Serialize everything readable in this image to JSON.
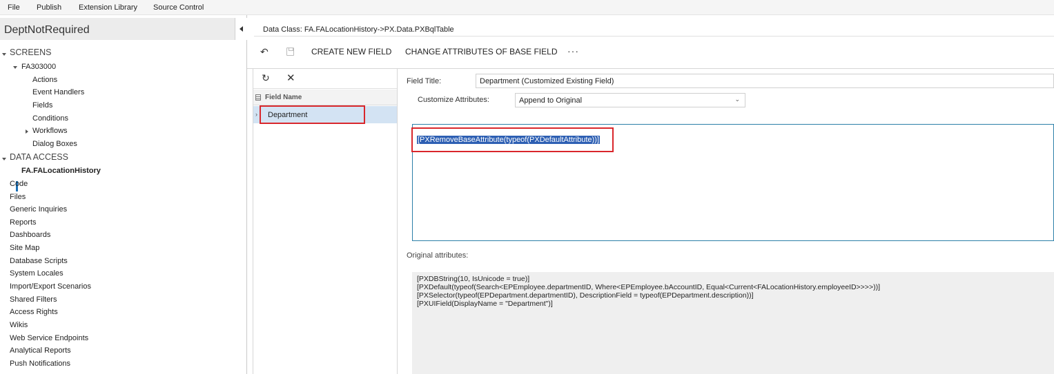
{
  "menubar": {
    "items": [
      "File",
      "Publish",
      "Extension Library",
      "Source Control"
    ]
  },
  "project": {
    "title": "DeptNotRequired"
  },
  "tree": {
    "screens_label": "SCREENS",
    "screen_id": "FA303000",
    "screen_children": [
      "Actions",
      "Event Handlers",
      "Fields",
      "Conditions",
      "Workflows",
      "Dialog Boxes"
    ],
    "data_access_label": "DATA ACCESS",
    "data_class": "FA.FALocationHistory",
    "other_items": [
      "Code",
      "Files",
      "Generic Inquiries",
      "Reports",
      "Dashboards",
      "Site Map",
      "Database Scripts",
      "System Locales",
      "Import/Export Scenarios",
      "Shared Filters",
      "Access Rights",
      "Wikis",
      "Web Service Endpoints",
      "Analytical Reports",
      "Push Notifications"
    ]
  },
  "main": {
    "data_class_text": "Data Class: FA.FALocationHistory->PX.Data.PXBqlTable",
    "toolbar": {
      "create_field": "CREATE NEW FIELD",
      "change_attributes": "CHANGE ATTRIBUTES OF BASE FIELD",
      "more": "···"
    },
    "fields": {
      "header": "Field Name",
      "rows": [
        "Department"
      ]
    },
    "field_title_label": "Field Title:",
    "field_title_value": "Department (Customized Existing Field)",
    "customize_label": "Customize Attributes:",
    "customize_value": "Append to Original",
    "editor_text": "[PXRemoveBaseAttribute(typeof(PXDefaultAttribute))]",
    "original_label": "Original attributes:",
    "original_lines": [
      "[PXDBString(10, IsUnicode = true)]",
      "[PXDefault(typeof(Search<EPEmployee.departmentID, Where<EPEmployee.bAccountID, Equal<Current<FALocationHistory.employeeID>>>>))]",
      "[PXSelector(typeof(EPDepartment.departmentID), DescriptionField = typeof(EPDepartment.description))]",
      "[PXUIField(DisplayName = \"Department\")]"
    ]
  },
  "colors": {
    "highlight": "#d9262b",
    "selection": "#2d5fb3",
    "row_selected": "#d3e3f3",
    "accent": "#1a6fb5"
  },
  "icons": [
    "collapse-icon",
    "undo-icon",
    "save-icon",
    "more-icon",
    "refresh-icon",
    "close-icon",
    "grid-icon",
    "chevron-down-icon"
  ]
}
